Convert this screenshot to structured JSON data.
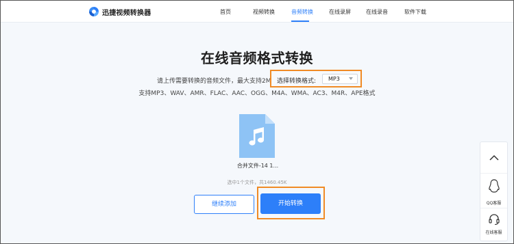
{
  "header": {
    "brand": "迅捷视频转换器",
    "nav": [
      "首页",
      "视频转换",
      "音频转换",
      "在线录屏",
      "在线录音",
      "软件下载"
    ],
    "active_nav": "音频转换"
  },
  "main": {
    "title": "在线音频格式转换",
    "upload_hint": "请上传需要转换的音频文件，最大支持2M",
    "format_label": "选择转换格式:",
    "format_value": "MP3",
    "supported_formats": "支持MP3、WAV、AMR、FLAC、AAC、OGG、M4A、WMA、AC3、M4R、APE格式",
    "file_name": "合并文件-14 1...",
    "summary": "选中1个文件，共1460.45K",
    "continue_button": "继续添加",
    "start_button": "开始转换"
  },
  "side": {
    "qq_label": "QQ客服",
    "online_label": "在线客服"
  },
  "colors": {
    "accent": "#2d7ff9",
    "highlight": "#f08a24",
    "file_icon": "#8ec3f5"
  },
  "icons": {
    "logo": "brand-logo-icon",
    "file": "music-file-icon",
    "up": "chevron-up-icon",
    "qq": "qq-penguin-icon",
    "online": "headset-icon"
  }
}
